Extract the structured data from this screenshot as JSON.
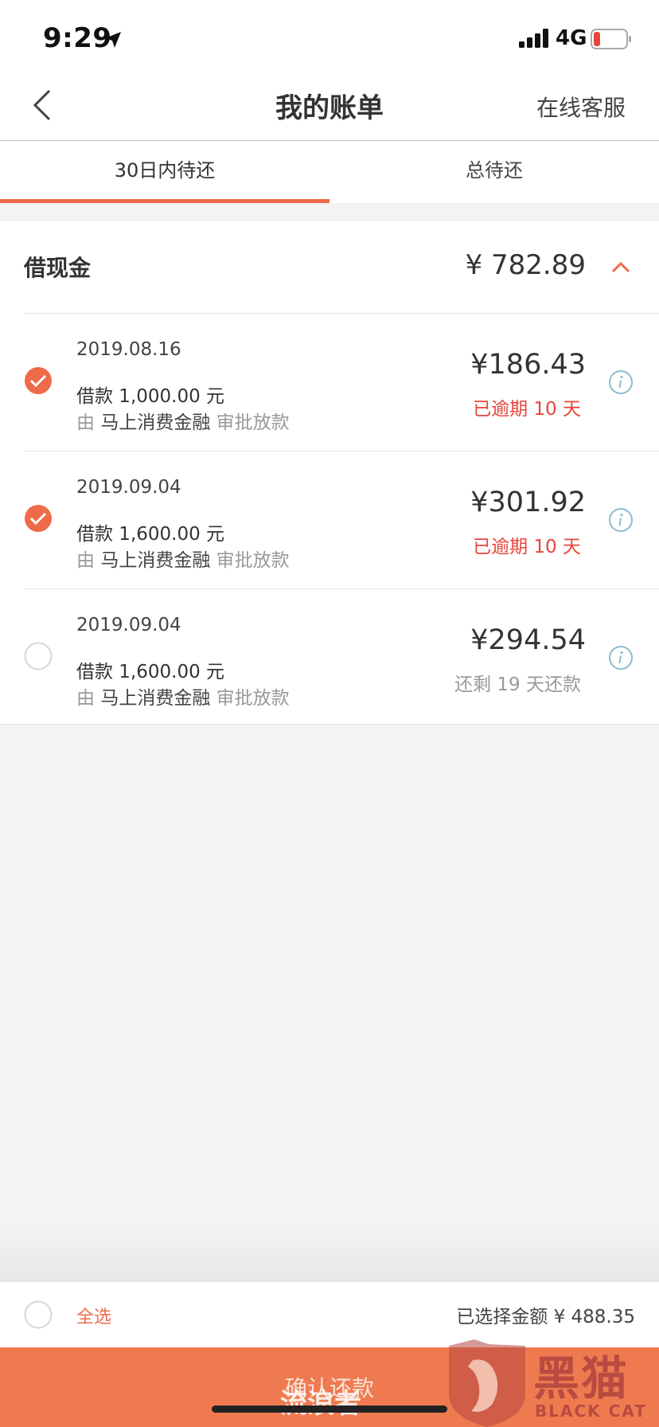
{
  "status_bar": {
    "time": "9:29",
    "network": "4G"
  },
  "nav": {
    "title": "我的账单",
    "service": "在线客服"
  },
  "tabs": [
    {
      "label": "30日内待还",
      "active": true
    },
    {
      "label": "总待还",
      "active": false
    }
  ],
  "section": {
    "title": "借现金",
    "total": "¥ 782.89"
  },
  "items": [
    {
      "date": "2019.08.16",
      "loan": "借款 1,000.00 元",
      "via_prefix": "由",
      "lender": "马上消费金融",
      "via_suffix": "审批放款",
      "amount": "¥186.43",
      "status": "已逾期 10 天",
      "status_type": "overdue",
      "selected": true
    },
    {
      "date": "2019.09.04",
      "loan": "借款 1,600.00 元",
      "via_prefix": "由",
      "lender": "马上消费金融",
      "via_suffix": "审批放款",
      "amount": "¥301.92",
      "status": "已逾期 10 天",
      "status_type": "overdue",
      "selected": true
    },
    {
      "date": "2019.09.04",
      "loan": "借款 1,600.00 元",
      "via_prefix": "由",
      "lender": "马上消费金融",
      "via_suffix": "审批放款",
      "amount": "¥294.54",
      "status": "还剩 19 天还款",
      "status_type": "remaining",
      "selected": false
    }
  ],
  "footer": {
    "select_all": "全选",
    "selected_amount": "已选择金额 ¥ 488.35"
  },
  "confirm": {
    "label": "确认还款"
  },
  "watermark": {
    "text": "流浪者",
    "brand_cn": "黑猫",
    "brand_en": "BLACK CAT"
  },
  "colors": {
    "accent": "#ef6a48",
    "overdue": "#e8443a",
    "confirm_bg": "#ef7a50"
  }
}
